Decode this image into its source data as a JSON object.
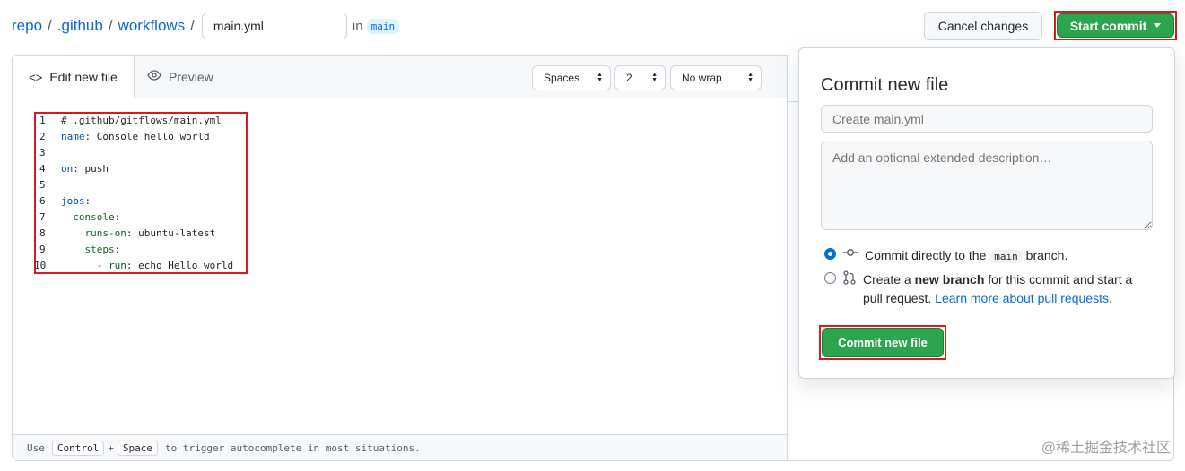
{
  "breadcrumb": {
    "repo": "repo",
    "sep": "/",
    "github": ".github",
    "workflows": "workflows",
    "filename_value": "main.yml",
    "in_text": "in",
    "branch": "main"
  },
  "header_buttons": {
    "cancel": "Cancel changes",
    "start_commit": "Start commit"
  },
  "editor": {
    "tabs": {
      "edit": "Edit new file",
      "preview": "Preview"
    },
    "selects": {
      "indent_mode": "Spaces",
      "indent_size": "2",
      "wrap_mode": "No wrap"
    },
    "lines": [
      {
        "num": "1",
        "key": "",
        "rest": "# .github/gitflows/main.yml"
      },
      {
        "num": "2",
        "key": "name",
        "rest": ": Console hello world"
      },
      {
        "num": "3",
        "key": "",
        "rest": ""
      },
      {
        "num": "4",
        "key": "on",
        "rest": ": push"
      },
      {
        "num": "5",
        "key": "",
        "rest": ""
      },
      {
        "num": "6",
        "key": "jobs",
        "rest": ":"
      },
      {
        "num": "7",
        "key": "  console",
        "rest": ":"
      },
      {
        "num": "8",
        "key": "    runs-on",
        "rest": ": ubuntu-latest"
      },
      {
        "num": "9",
        "key": "    steps",
        "rest": ":"
      },
      {
        "num": "10",
        "key": "      - run",
        "rest": ": echo Hello world"
      }
    ],
    "footer": {
      "use": "Use",
      "key1": "Control",
      "plus": "+",
      "key2": "Space",
      "rest": "to trigger autocomplete in most situations."
    }
  },
  "commit_popover": {
    "title": "Commit new file",
    "summary_placeholder": "Create main.yml",
    "description_placeholder": "Add an optional extended description…",
    "option_direct": {
      "prefix": "Commit directly to the",
      "branch": "main",
      "suffix": "branch.",
      "checked": true
    },
    "option_new_branch": {
      "prefix": "Create a",
      "bold": "new branch",
      "middle": "for this commit and start a pull request.",
      "link": "Learn more about pull requests.",
      "checked": false
    },
    "commit_button": "Commit new file"
  },
  "watermark": "@稀土掘金技术社区",
  "colors": {
    "accent_blue": "#0969da",
    "green_button": "#2da44e",
    "highlight_red": "#d71920"
  },
  "icons": {
    "code_tab": "code-icon",
    "preview_tab": "eye-icon",
    "commit": "git-commit-icon",
    "pull_request": "git-pull-request-icon"
  }
}
